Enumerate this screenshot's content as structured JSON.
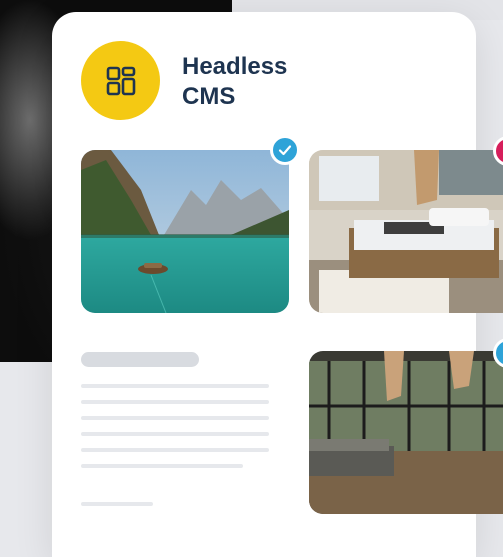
{
  "app": {
    "title_line1": "Headless",
    "title_line2": "CMS"
  },
  "logo": {
    "icon": "dashboard-grid-icon",
    "color": "#f4c913"
  },
  "images": [
    {
      "name": "mountain-lake-image",
      "selected": true
    },
    {
      "name": "bedroom-image",
      "selected": false
    },
    {
      "name": "sunroom-image",
      "selected": false
    }
  ],
  "colors": {
    "title": "#1e3450",
    "check_badge": "#2ea3d8",
    "pink_badge": "#d61e5b",
    "blue_badge": "#2ea3d8",
    "placeholder": "#e6e8ec"
  }
}
